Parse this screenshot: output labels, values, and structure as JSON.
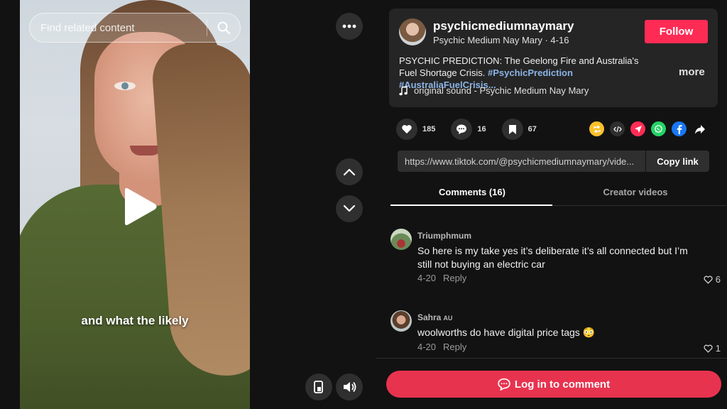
{
  "search": {
    "placeholder": "Find related content"
  },
  "video": {
    "caption": "and what the likely"
  },
  "author": {
    "username": "psychicmediumnaymary",
    "subline": "Psychic Medium Nay Mary · 4-16",
    "follow_label": "Follow"
  },
  "post": {
    "description": "PSYCHIC PREDICTION: The Geelong Fire and Australia's Fuel Shortage Crisis. ",
    "hashtags": "#PsychicPrediction #AustraliaFuelCrisis...",
    "more_label": "more",
    "sound": "original sound - Psychic Medium Nay Mary"
  },
  "stats": {
    "likes": "185",
    "comments": "16",
    "saves": "67"
  },
  "share_link": {
    "url": "https://www.tiktok.com/@psychicmediumnaymary/vide...",
    "copy_label": "Copy link"
  },
  "tabs": [
    {
      "label": "Comments (16)",
      "active": true
    },
    {
      "label": "Creator videos",
      "active": false
    }
  ],
  "comments": [
    {
      "user": "Triumphmum",
      "badge": "",
      "text": "So here is my take yes it’s deliberate it’s all connected but I’m still not buying an electric car",
      "date": "4-20",
      "reply_label": "Reply",
      "likes": "6"
    },
    {
      "user": "Sahra",
      "badge": "AU",
      "text": "woolworths do have digital price tags 😳",
      "date": "4-20",
      "reply_label": "Reply",
      "likes": "1"
    }
  ],
  "login": {
    "label": "Log in to comment"
  },
  "colors": {
    "accent": "#fe2c55",
    "login_button": "#e8334f",
    "hashtag": "#8bb4e6"
  }
}
